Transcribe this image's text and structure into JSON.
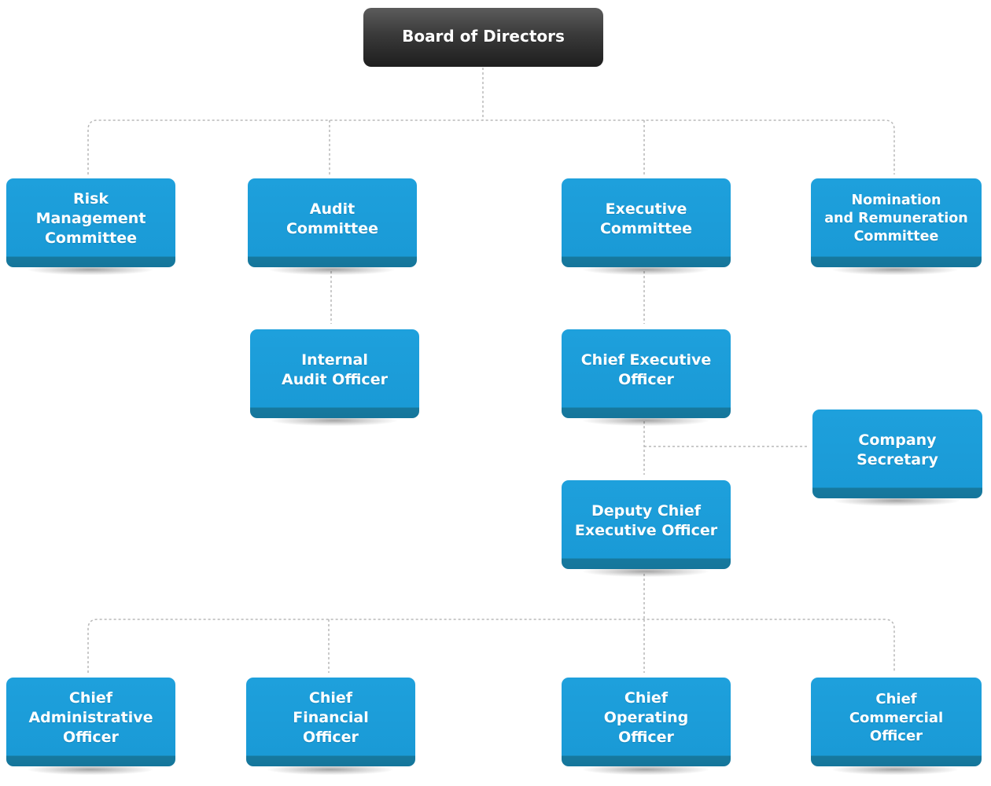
{
  "diagram": {
    "type": "organizational-chart",
    "colors": {
      "root_box": "#2b2b2b",
      "node_box": "#1a9fdb",
      "node_box_edge": "#16799f",
      "connector": "#bdbdbd",
      "label": "#ffffff"
    },
    "nodes": {
      "board": {
        "label": "Board of Directors"
      },
      "risk": {
        "label": "Risk\nManagement\nCommittee"
      },
      "audit": {
        "label": "Audit\nCommittee"
      },
      "executive": {
        "label": "Executive\nCommittee"
      },
      "nomination": {
        "label": "Nomination\nand Remuneration\nCommittee"
      },
      "internal_audit": {
        "label": "Internal\nAudit Officer"
      },
      "ceo": {
        "label": "Chief Executive\nOfficer"
      },
      "secretary": {
        "label": "Company\nSecretary"
      },
      "deputy_ceo": {
        "label": "Deputy Chief\nExecutive Officer"
      },
      "cao": {
        "label": "Chief\nAdministrative\nOfficer"
      },
      "cfo": {
        "label": "Chief\nFinancial\nOfficer"
      },
      "coo": {
        "label": "Chief\nOperating\nOfficer"
      },
      "cco": {
        "label": "Chief\nCommercial\nOfficer"
      }
    },
    "edges": [
      {
        "from": "board",
        "to": "risk"
      },
      {
        "from": "board",
        "to": "audit"
      },
      {
        "from": "board",
        "to": "executive"
      },
      {
        "from": "board",
        "to": "nomination"
      },
      {
        "from": "audit",
        "to": "internal_audit"
      },
      {
        "from": "executive",
        "to": "ceo"
      },
      {
        "from": "ceo",
        "to": "secretary"
      },
      {
        "from": "ceo",
        "to": "deputy_ceo"
      },
      {
        "from": "deputy_ceo",
        "to": "cao"
      },
      {
        "from": "deputy_ceo",
        "to": "cfo"
      },
      {
        "from": "deputy_ceo",
        "to": "coo"
      },
      {
        "from": "deputy_ceo",
        "to": "cco"
      }
    ]
  }
}
